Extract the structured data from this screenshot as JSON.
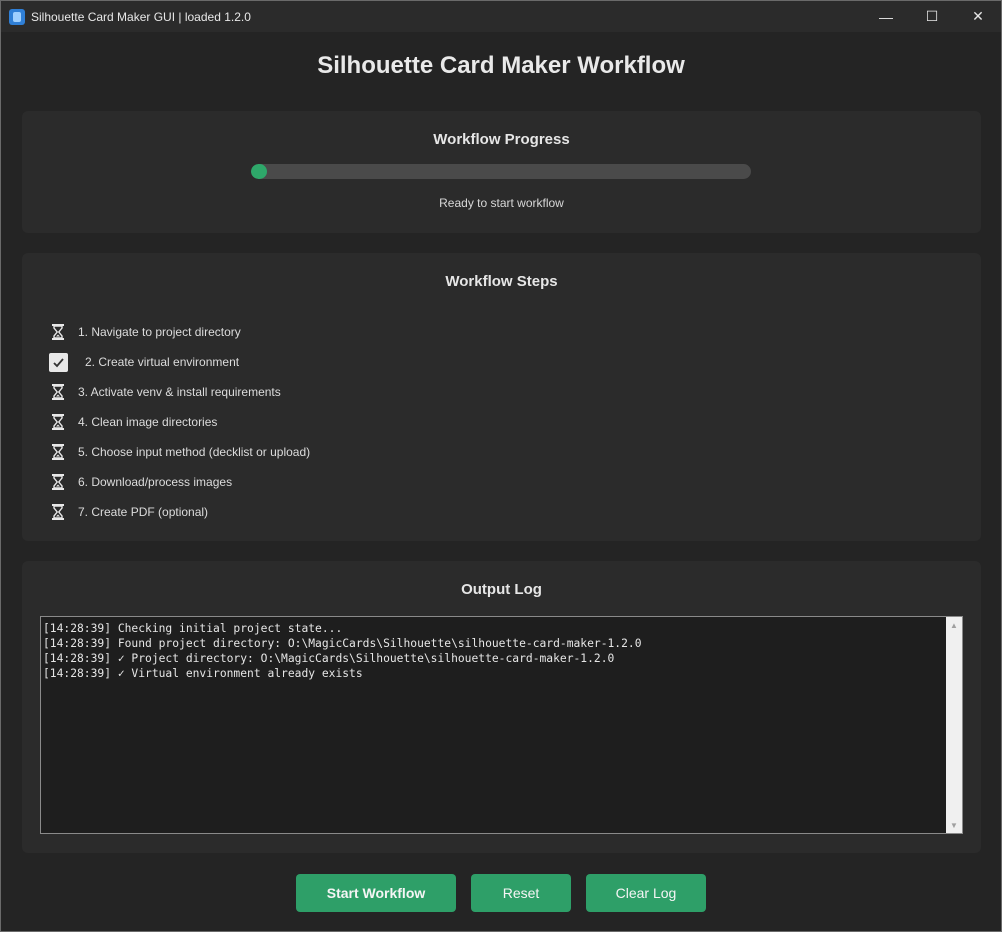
{
  "window": {
    "title": "Silhouette Card Maker GUI | loaded 1.2.0",
    "controls": {
      "minimize": "—",
      "maximize": "☐",
      "close": "✕"
    }
  },
  "main_title": "Silhouette Card Maker Workflow",
  "progress_panel": {
    "title": "Workflow Progress",
    "progress_fraction": 0.02,
    "status": "Ready to start workflow",
    "accent_color": "#2ea86a"
  },
  "steps_panel": {
    "title": "Workflow Steps",
    "steps": [
      {
        "label": "1. Navigate to project directory",
        "state": "pending",
        "icon": "hourglass-icon"
      },
      {
        "label": "2. Create virtual environment",
        "state": "done",
        "icon": "check-icon"
      },
      {
        "label": "3. Activate venv & install requirements",
        "state": "pending",
        "icon": "hourglass-icon"
      },
      {
        "label": "4. Clean image directories",
        "state": "pending",
        "icon": "hourglass-icon"
      },
      {
        "label": "5. Choose input method (decklist or upload)",
        "state": "pending",
        "icon": "hourglass-icon"
      },
      {
        "label": "6. Download/process images",
        "state": "pending",
        "icon": "hourglass-icon"
      },
      {
        "label": "7. Create PDF (optional)",
        "state": "pending",
        "icon": "hourglass-icon"
      }
    ]
  },
  "log_panel": {
    "title": "Output Log",
    "lines": [
      "[14:28:39] Checking initial project state...",
      "[14:28:39] Found project directory: O:\\MagicCards\\Silhouette\\silhouette-card-maker-1.2.0",
      "[14:28:39] ✓ Project directory: O:\\MagicCards\\Silhouette\\silhouette-card-maker-1.2.0",
      "[14:28:39] ✓ Virtual environment already exists"
    ]
  },
  "buttons": {
    "start": "Start Workflow",
    "reset": "Reset",
    "clear_log": "Clear Log",
    "color": "#2e9f68"
  }
}
